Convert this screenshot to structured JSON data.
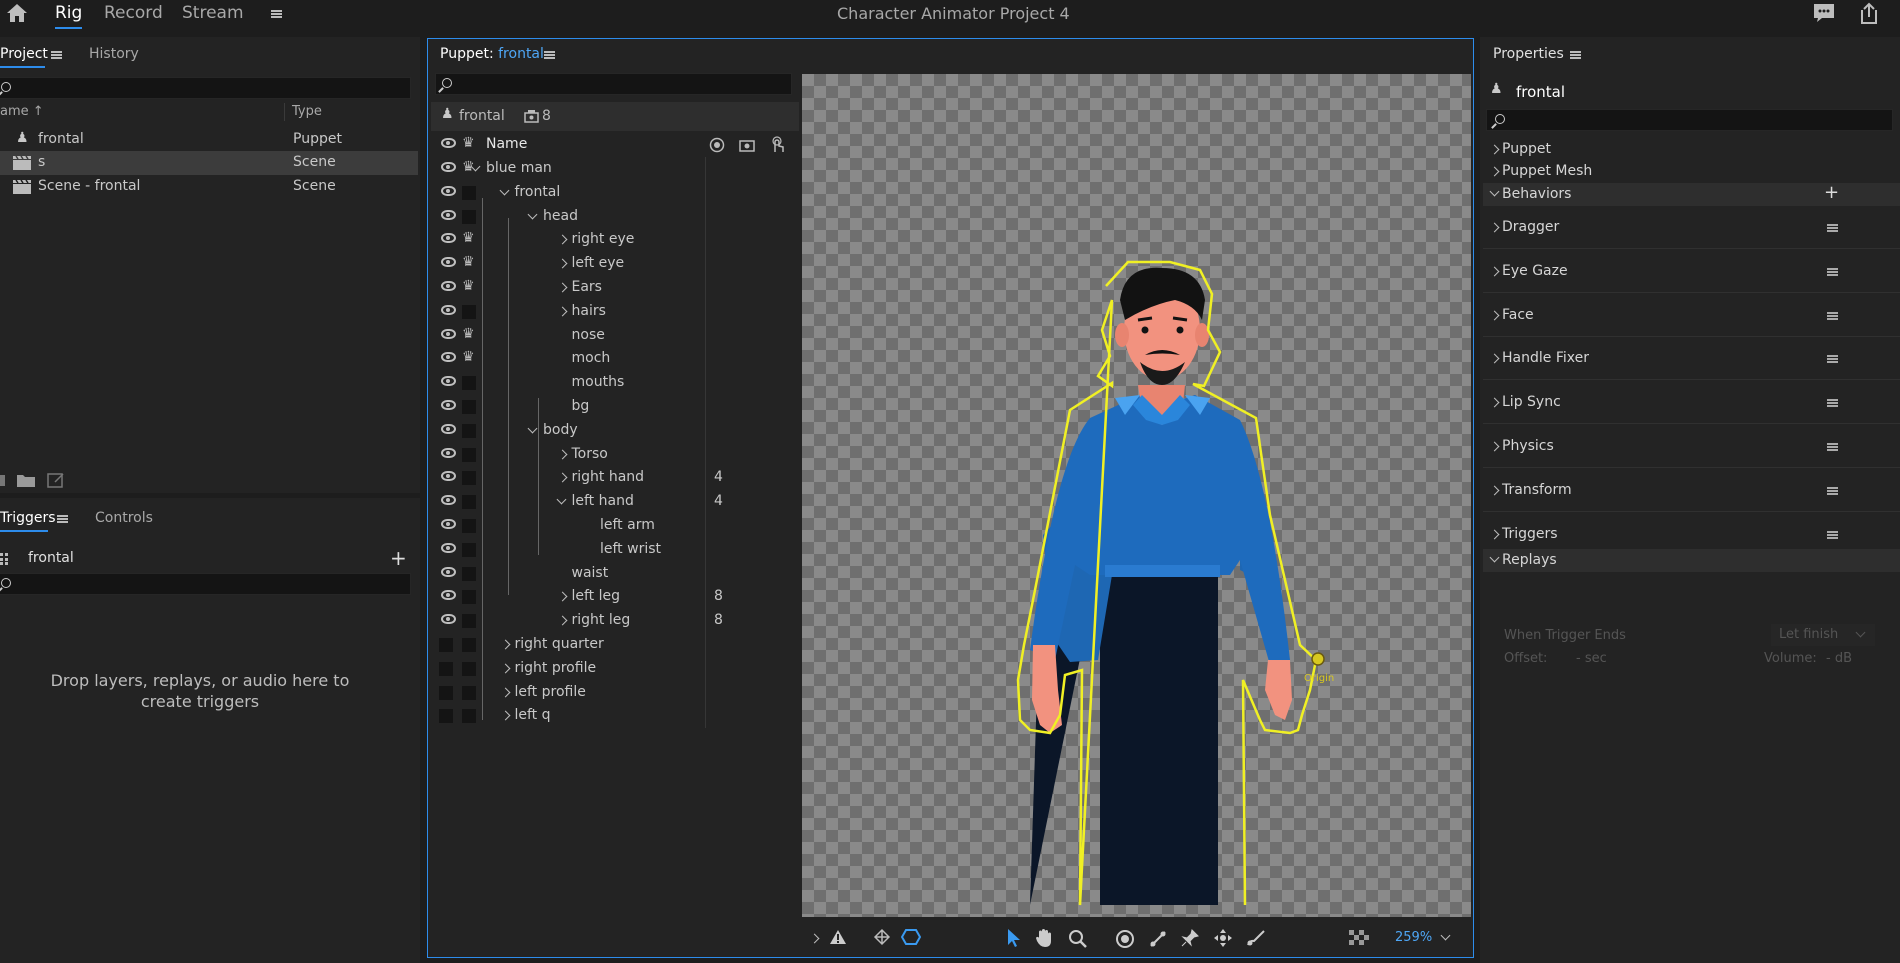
{
  "app": {
    "title": "Character Animator Project 4",
    "tabs": [
      "Rig",
      "Record",
      "Stream"
    ],
    "active_tab": "Rig"
  },
  "project_panel": {
    "tabs": [
      "Project",
      "History"
    ],
    "col_name": "ame",
    "col_type": "Type",
    "items": [
      {
        "name": "frontal",
        "type": "Puppet"
      },
      {
        "name": "s",
        "type": "Scene"
      },
      {
        "name": "Scene - frontal",
        "type": "Scene"
      }
    ]
  },
  "triggers_panel": {
    "tabs": [
      "Triggers",
      "Controls"
    ],
    "puppet": "frontal",
    "empty_text": "Drop layers, replays, or audio here to create triggers"
  },
  "puppet_panel": {
    "label": "Puppet:",
    "name": "frontal",
    "header_puppet": "frontal",
    "count": "8",
    "col_name": "Name",
    "layers": [
      {
        "name": "blue man",
        "depth": 1,
        "exp": "d",
        "crown": true,
        "num": ""
      },
      {
        "name": "frontal",
        "depth": 2,
        "exp": "d",
        "crown": false,
        "num": ""
      },
      {
        "name": "head",
        "depth": 3,
        "exp": "d",
        "crown": false,
        "num": ""
      },
      {
        "name": "right eye",
        "depth": 4,
        "exp": "r",
        "crown": true,
        "num": ""
      },
      {
        "name": "left eye",
        "depth": 4,
        "exp": "r",
        "crown": true,
        "num": ""
      },
      {
        "name": "Ears",
        "depth": 4,
        "exp": "r",
        "crown": true,
        "num": ""
      },
      {
        "name": "hairs",
        "depth": 4,
        "exp": "r",
        "crown": false,
        "num": ""
      },
      {
        "name": "nose",
        "depth": 4,
        "exp": "",
        "crown": true,
        "num": ""
      },
      {
        "name": "moch",
        "depth": 4,
        "exp": "",
        "crown": true,
        "num": ""
      },
      {
        "name": "mouths",
        "depth": 4,
        "exp": "",
        "crown": false,
        "num": ""
      },
      {
        "name": "bg",
        "depth": 4,
        "exp": "",
        "crown": false,
        "num": ""
      },
      {
        "name": "body",
        "depth": 3,
        "exp": "d",
        "crown": false,
        "num": ""
      },
      {
        "name": "Torso",
        "depth": 4,
        "exp": "r",
        "crown": false,
        "num": ""
      },
      {
        "name": "right hand",
        "depth": 4,
        "exp": "r",
        "crown": false,
        "num": "4"
      },
      {
        "name": "left hand",
        "depth": 4,
        "exp": "d",
        "crown": false,
        "num": "4"
      },
      {
        "name": "left arm",
        "depth": 5,
        "exp": "",
        "crown": false,
        "num": ""
      },
      {
        "name": "left wrist",
        "depth": 5,
        "exp": "",
        "crown": false,
        "num": ""
      },
      {
        "name": "waist",
        "depth": 4,
        "exp": "",
        "crown": false,
        "num": ""
      },
      {
        "name": "left leg",
        "depth": 4,
        "exp": "r",
        "crown": false,
        "num": "8"
      },
      {
        "name": "right leg",
        "depth": 4,
        "exp": "r",
        "crown": false,
        "num": "8"
      },
      {
        "name": "right quarter",
        "depth": 2,
        "exp": "r",
        "crown": false,
        "num": "",
        "hidden": true
      },
      {
        "name": "right profile",
        "depth": 2,
        "exp": "r",
        "crown": false,
        "num": "",
        "hidden": true
      },
      {
        "name": "left profile",
        "depth": 2,
        "exp": "r",
        "crown": false,
        "num": "",
        "hidden": true
      },
      {
        "name": "left q",
        "depth": 2,
        "exp": "r",
        "crown": false,
        "num": "",
        "hidden": true
      }
    ]
  },
  "canvas": {
    "handle_label": "Origin",
    "zoom": "259%"
  },
  "properties": {
    "title": "Properties",
    "puppet": "frontal",
    "sections": [
      "Puppet",
      "Puppet Mesh",
      "Behaviors"
    ],
    "behaviors": [
      "Dragger",
      "Eye Gaze",
      "Face",
      "Handle Fixer",
      "Lip Sync",
      "Physics",
      "Transform",
      "Triggers"
    ],
    "replays": "Replays",
    "replay_fields": {
      "when_ends": "When Trigger Ends",
      "finish": "Let finish",
      "offset": "Offset:",
      "offset_val": "- sec",
      "volume": "Volume:",
      "volume_val": "- dB"
    }
  }
}
